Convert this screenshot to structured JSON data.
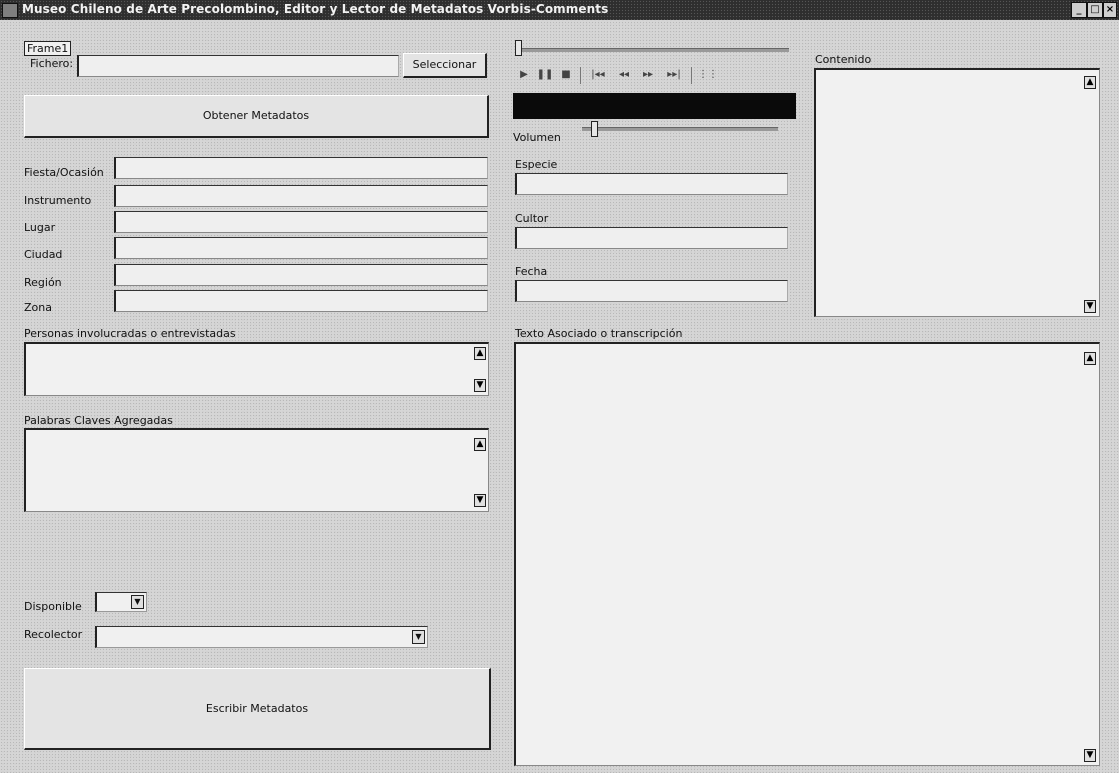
{
  "window": {
    "title": "Museo Chileno de Arte Precolombino, Editor y Lector de Metadatos Vorbis-Comments",
    "controls": {
      "minimize": "_",
      "maximize": "□",
      "close": "×"
    }
  },
  "frame_label": "Frame1",
  "file": {
    "label": "Fichero:",
    "value": "",
    "select_button": "Seleccionar"
  },
  "get_metadata_button": "Obtener Metadatos",
  "fields": {
    "fiesta": {
      "label": "Fiesta/Ocasión",
      "value": ""
    },
    "instrumento": {
      "label": "Instrumento",
      "value": ""
    },
    "lugar": {
      "label": "Lugar",
      "value": ""
    },
    "ciudad": {
      "label": "Ciudad",
      "value": ""
    },
    "region": {
      "label": "Región",
      "value": ""
    },
    "zona": {
      "label": "Zona",
      "value": ""
    },
    "especie": {
      "label": "Especie",
      "value": ""
    },
    "cultor": {
      "label": "Cultor",
      "value": ""
    },
    "fecha": {
      "label": "Fecha",
      "value": ""
    }
  },
  "personas": {
    "label": "Personas involucradas o entrevistadas",
    "value": ""
  },
  "palabras": {
    "label": "Palabras Claves Agregadas",
    "value": ""
  },
  "disponible": {
    "label": "Disponible",
    "value": ""
  },
  "recolector": {
    "label": "Recolector",
    "value": ""
  },
  "write_metadata_button": "Escribir Metadatos",
  "player": {
    "position_fraction": 0.0,
    "volume_label": "Volumen",
    "volume_fraction": 0.05,
    "controls": [
      "play",
      "pause",
      "stop",
      "skip-back",
      "rewind",
      "forward",
      "skip-forward",
      "playlist"
    ]
  },
  "contenido": {
    "label": "Contenido",
    "value": ""
  },
  "texto": {
    "label": "Texto Asociado o transcripción",
    "value": ""
  },
  "icons": {
    "play": "▶",
    "pause": "❚❚",
    "stop": "■",
    "skip_back": "|◂◂",
    "rewind": "◂◂",
    "forward": "▸▸",
    "skip_forward": "▸▸|",
    "playlist": "⋮⋮",
    "up": "▲",
    "down": "▼"
  }
}
